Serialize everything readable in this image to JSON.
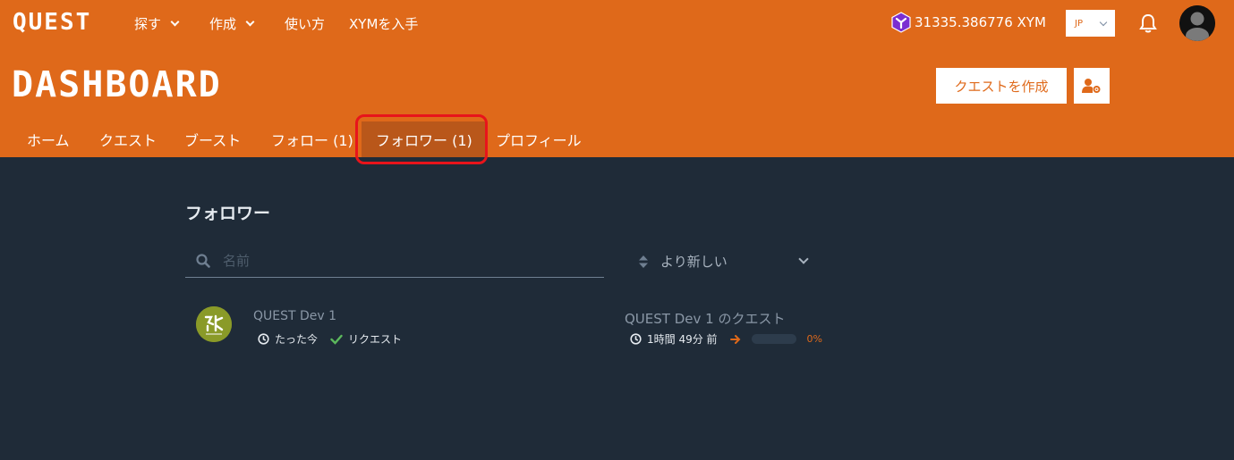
{
  "brand": {
    "logo": "QUEST",
    "accent": "#df691a"
  },
  "topnav": {
    "items": [
      {
        "label": "探す",
        "dropdown": true
      },
      {
        "label": "作成",
        "dropdown": true
      },
      {
        "label": "使い方",
        "dropdown": false
      },
      {
        "label": "XYMを入手",
        "dropdown": false
      }
    ],
    "balance": "31335.386776 XYM",
    "language": "JP"
  },
  "page": {
    "title": "DASHBOARD",
    "create_button": "クエストを作成"
  },
  "tabs": [
    {
      "label": "ホーム"
    },
    {
      "label": "クエスト"
    },
    {
      "label": "ブースト"
    },
    {
      "label": "フォロー (1)"
    },
    {
      "label": "フォロワー (1)",
      "active": true
    },
    {
      "label": "プロフィール"
    }
  ],
  "main": {
    "section_title": "フォロワー",
    "search_placeholder": "名前",
    "sort_label": "より新しい",
    "followers": [
      {
        "name": "QUEST Dev 1",
        "time": "たった今",
        "status": "リクエスト",
        "quest_title": "QUEST Dev 1 のクエスト",
        "quest_time": "1時間 49分 前",
        "progress": 0,
        "progress_label": "0%"
      }
    ]
  }
}
